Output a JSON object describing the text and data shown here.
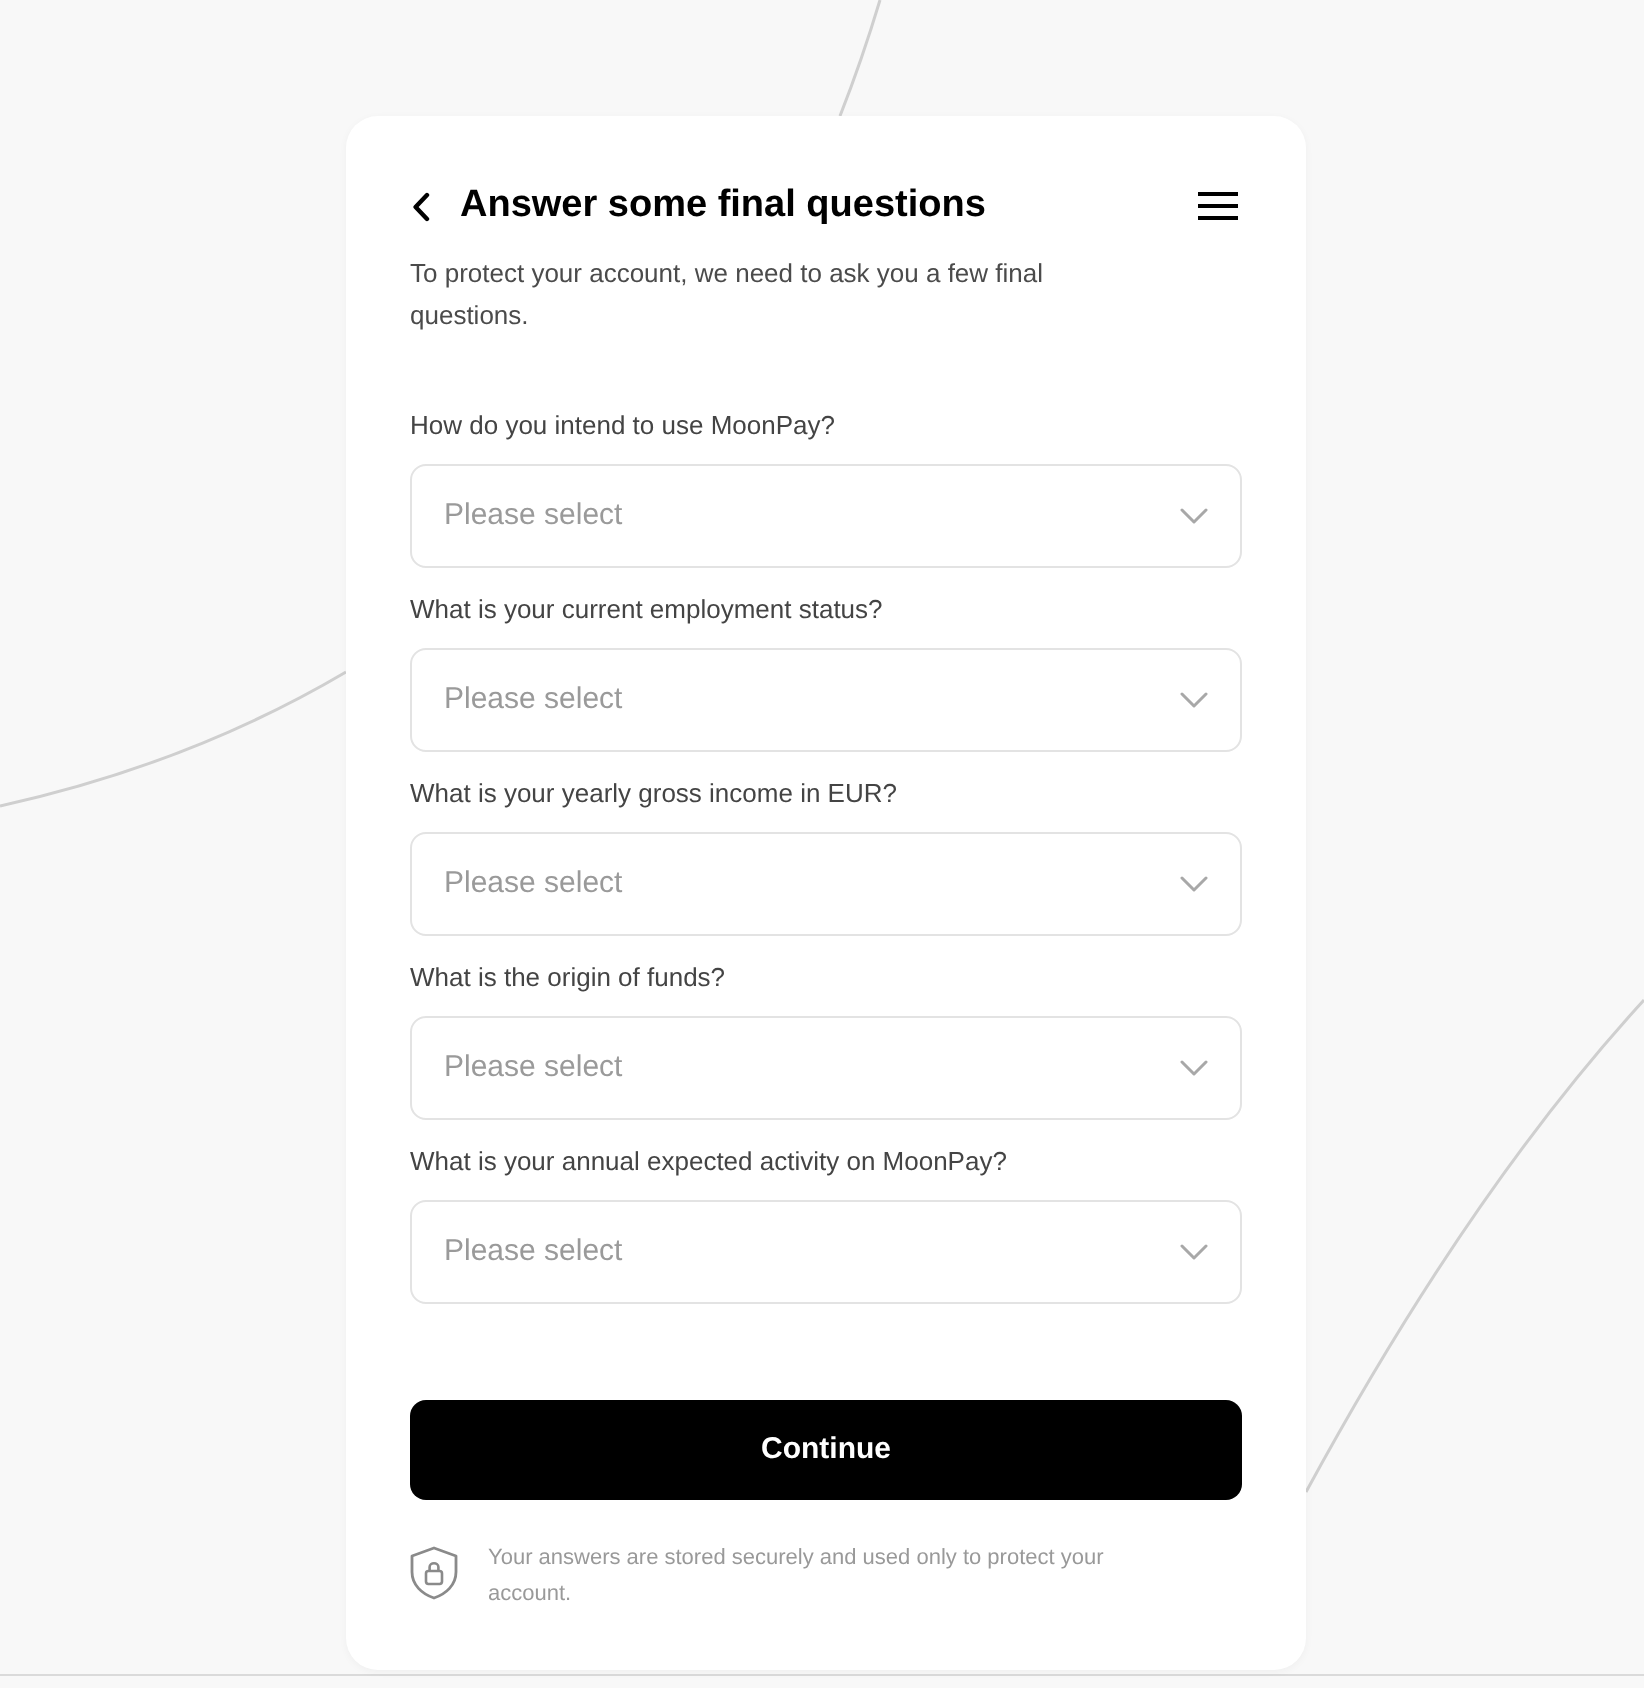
{
  "header": {
    "title": "Answer some final questions",
    "subtitle": "To protect your account, we need to ask you a few final questions."
  },
  "questions": [
    {
      "label": "How do you intend to use MoonPay?",
      "placeholder": "Please select"
    },
    {
      "label": "What is your current employment status?",
      "placeholder": "Please select"
    },
    {
      "label": "What is your yearly gross income in EUR?",
      "placeholder": "Please select"
    },
    {
      "label": "What is the origin of funds?",
      "placeholder": "Please select"
    },
    {
      "label": "What is your annual expected activity on MoonPay?",
      "placeholder": "Please select"
    }
  ],
  "continue_button": "Continue",
  "footer_note": "Your answers are stored securely and used only to protect your account."
}
